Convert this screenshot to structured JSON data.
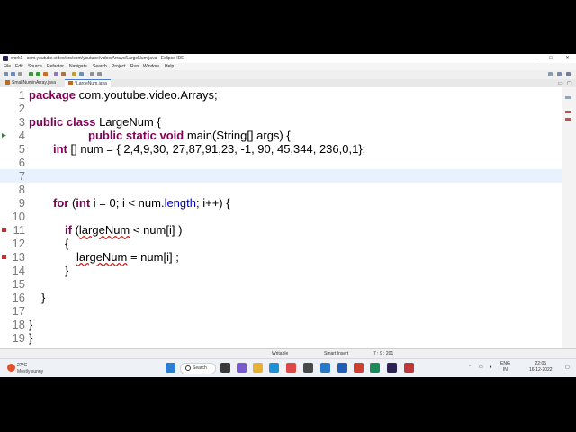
{
  "window": {
    "title": "work1 - com.youtube.video/src/com/youtube/video/Arrays/LargeNum.java - Eclipse IDE",
    "minimize": "─",
    "maximize": "□",
    "close": "✕"
  },
  "menu": [
    "File",
    "Edit",
    "Source",
    "Refactor",
    "Navigate",
    "Search",
    "Project",
    "Run",
    "Window",
    "Help"
  ],
  "tabs": [
    {
      "label": "SmallNuminArray.java",
      "active": false
    },
    {
      "label": "*LargeNum.java",
      "active": true
    }
  ],
  "editor": {
    "line_numbers": [
      "1",
      "2",
      "3",
      "4",
      "5",
      "6",
      "7",
      "8",
      "9",
      "10",
      "11",
      "12",
      "13",
      "14",
      "15",
      "16",
      "17",
      "18",
      "19"
    ],
    "current_line": 7,
    "code": {
      "l1_kw": "package",
      "l1_rest": " com.youtube.video.Arrays;",
      "l3_kw1": "public",
      "l3_kw2": "class",
      "l3_rest": " LargeNum {",
      "l4_kw1": "public",
      "l4_kw2": "static",
      "l4_kw3": "void",
      "l4_rest": " main(String[] args) {",
      "l5_kw": "int",
      "l5_rest": " [] num = { 2,4,9,30, 27,87,91,23, -1, 90, 45,344, 236,0,1};",
      "l9_kw1": "for",
      "l9_a": " (",
      "l9_kw2": "int",
      "l9_b": " i = 0; i < num.",
      "l9_fld": "length",
      "l9_c": "; i++) {",
      "l11_kw": "if",
      "l11_a": " (",
      "l11_var": "largeNum",
      "l11_b": " < num[i] )",
      "l12": "{",
      "l13_var": "largeNum",
      "l13_rest": " = num[i] ;",
      "l14": "}",
      "l16": "}",
      "l18": "}",
      "l19": "}"
    }
  },
  "status": {
    "writable": "Writable",
    "insert": "Smart Insert",
    "position": "7 : 9 : 201"
  },
  "taskbar": {
    "weather_temp": "27°C",
    "weather_desc": "Mostly sunny",
    "search": "Search",
    "lang_top": "ENG",
    "lang_bottom": "IN",
    "time": "22:05",
    "date": "16-12-2022"
  },
  "colors": {
    "keyword": "#7f0055",
    "field": "#0000c0",
    "current_line": "#e8f2fe"
  }
}
